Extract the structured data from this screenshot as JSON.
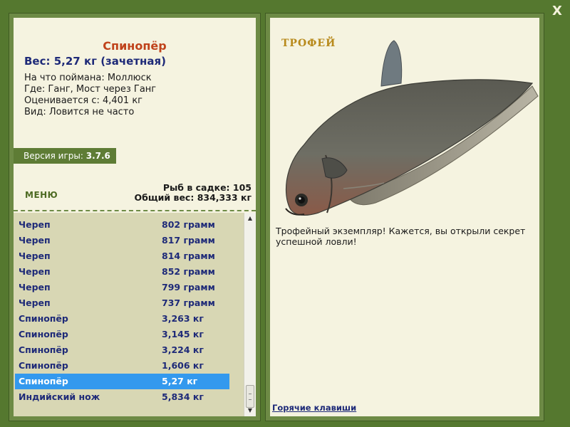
{
  "close_label": "X",
  "fish": {
    "name": "Спинопёр",
    "weight_line": "Вес: 5,27 кг (зачетная)",
    "bait_line": "На что поймана: Моллюск",
    "location_line": "Где: Ганг, Мост через Ганг",
    "min_weight_line": "Оценивается с: 4,401 кг",
    "rarity_line": "Вид: Ловится не часто"
  },
  "version": {
    "label": "Версия игры: ",
    "value": "3.7.6"
  },
  "menu_label": "МЕНЮ",
  "stats": {
    "count_line": "Рыб в садке: 105",
    "total_line": "Общий вес: 834,333 кг"
  },
  "catch_list": [
    {
      "name": "Череп",
      "weight": "802 грамм",
      "selected": false
    },
    {
      "name": "Череп",
      "weight": "817 грамм",
      "selected": false
    },
    {
      "name": "Череп",
      "weight": "814 грамм",
      "selected": false
    },
    {
      "name": "Череп",
      "weight": "852 грамм",
      "selected": false
    },
    {
      "name": "Череп",
      "weight": "799 грамм",
      "selected": false
    },
    {
      "name": "Череп",
      "weight": "737 грамм",
      "selected": false
    },
    {
      "name": "Спинопёр",
      "weight": "3,263 кг",
      "selected": false
    },
    {
      "name": "Спинопёр",
      "weight": "3,145 кг",
      "selected": false
    },
    {
      "name": "Спинопёр",
      "weight": "3,224 кг",
      "selected": false
    },
    {
      "name": "Спинопёр",
      "weight": "1,606 кг",
      "selected": false
    },
    {
      "name": "Спинопёр",
      "weight": "5,27 кг",
      "selected": true
    },
    {
      "name": "Индийский нож",
      "weight": "5,834 кг",
      "selected": false
    }
  ],
  "trophy": {
    "label": "ТРОФЕЙ",
    "text": "Трофейный экземпляр! Кажется, вы открыли секрет успешной ловли!"
  },
  "hotkeys_label": "Горячие клавиши",
  "colors": {
    "frame_green": "#55782f",
    "parchment": "#f5f3e0",
    "list_bg": "#d8d7b4",
    "selection": "#3399ee",
    "title_orange": "#c0431c",
    "link_blue": "#1e2a78"
  },
  "icons": [
    "close-icon",
    "scroll-up-arrow-icon",
    "scroll-down-arrow-icon",
    "fish-illustration-icon"
  ]
}
